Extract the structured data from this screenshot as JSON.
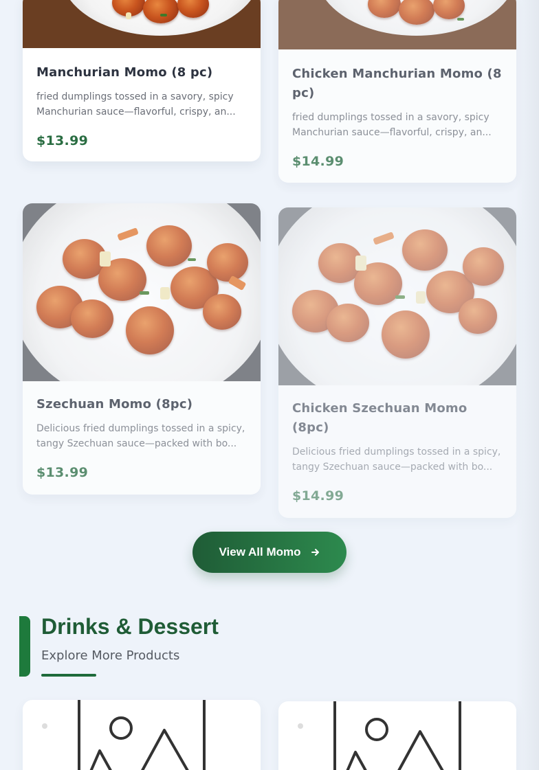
{
  "products": [
    {
      "title": "Manchurian Momo (8 pc)",
      "description": "fried dumplings tossed in a savory, spicy Manchurian sauce—flavorful, crispy, an...",
      "price": "$13.99"
    },
    {
      "title": "Chicken Manchurian Momo (8 pc)",
      "description": "fried dumplings tossed in a savory, spicy Manchurian sauce—flavorful, crispy, an...",
      "price": "$14.99"
    },
    {
      "title": "Szechuan Momo (8pc)",
      "description": "Delicious fried dumplings tossed in a spicy, tangy Szechuan sauce—packed with bo...",
      "price": "$13.99"
    },
    {
      "title": "Chicken Szechuan Momo (8pc)",
      "description": "Delicious fried dumplings tossed in a spicy, tangy Szechuan sauce—packed with bo...",
      "price": "$14.99"
    }
  ],
  "view_all_button": {
    "label": "View All Momo",
    "icon": "arrow-right-icon"
  },
  "section": {
    "title": "Drinks & Dessert",
    "subtitle": "Explore More Products",
    "accent_color": "#1e7a3c"
  },
  "placeholder_icon": "image-placeholder-icon",
  "colors": {
    "price": "#2a6d42",
    "button_start": "#1f5c36",
    "button_end": "#2d8a4e"
  }
}
